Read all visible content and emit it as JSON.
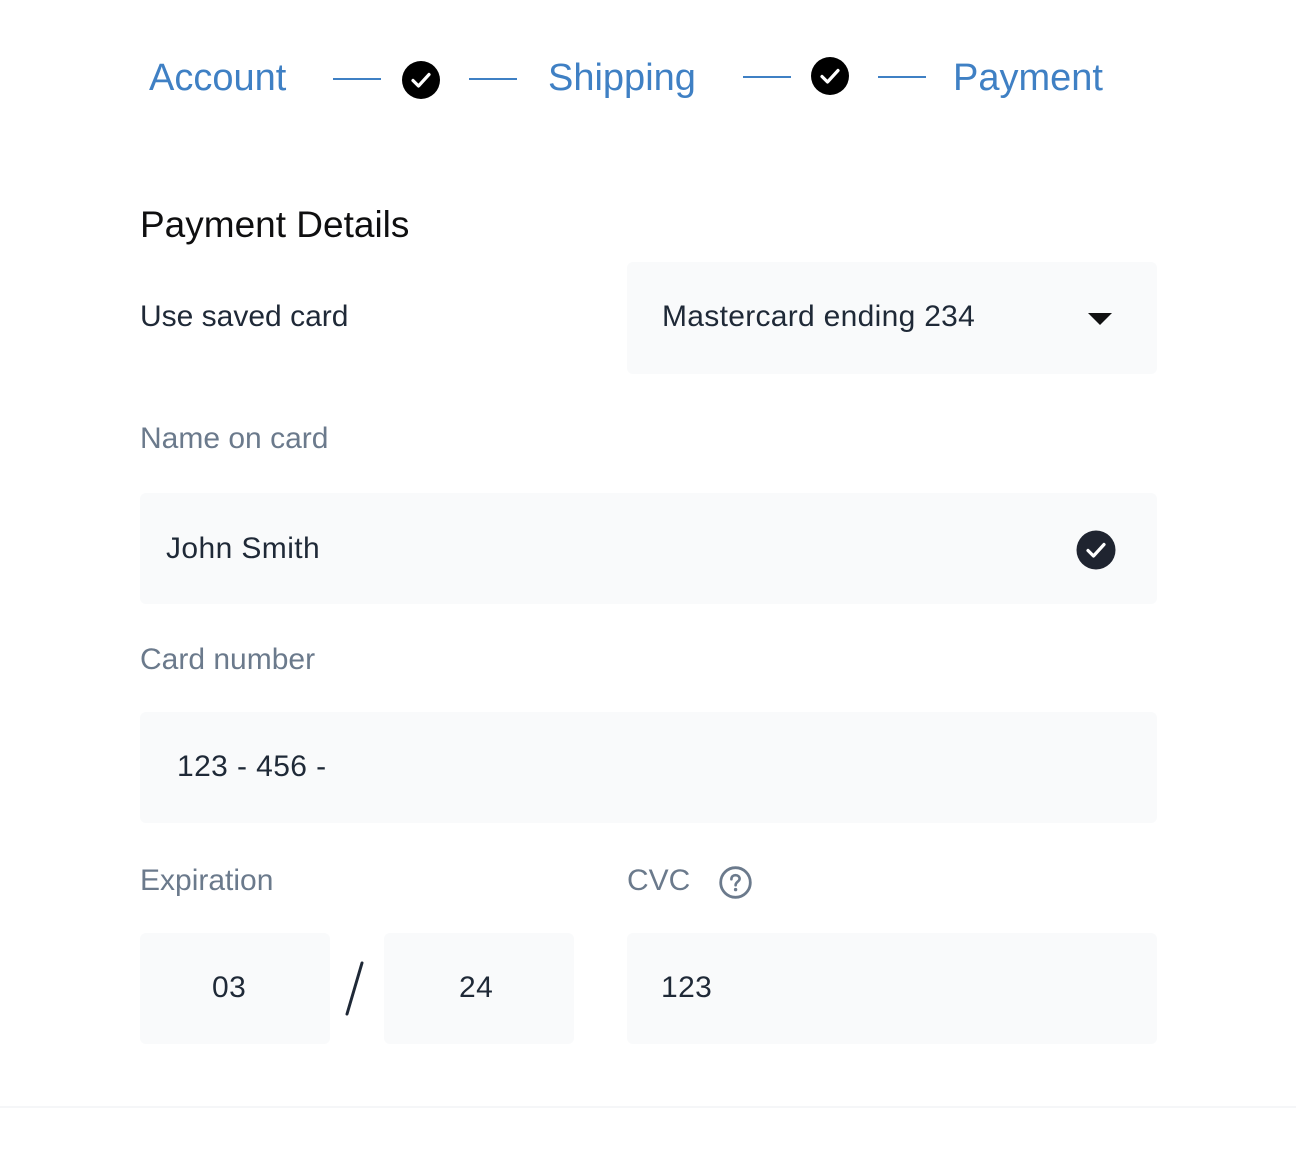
{
  "stepper": {
    "steps": [
      {
        "label": "Account",
        "completed": true
      },
      {
        "label": "Shipping",
        "completed": true
      },
      {
        "label": "Payment",
        "completed": false
      }
    ],
    "accent_color": "#3f80c4",
    "check_icon": "check-circle-icon"
  },
  "form": {
    "title": "Payment Details",
    "saved_card": {
      "label": "Use saved card",
      "selected_value": "Mastercard ending 234",
      "icon": "caret-down-icon"
    },
    "name_on_card": {
      "label": "Name on card",
      "value": "John Smith",
      "valid": true,
      "icon": "check-circle-icon"
    },
    "card_number": {
      "label": "Card number",
      "value": "123 - 456 -"
    },
    "expiration": {
      "label": "Expiration",
      "month": "03",
      "year": "24"
    },
    "cvc": {
      "label": "CVC",
      "value": "123",
      "help_icon": "question-circle-icon"
    }
  },
  "colors": {
    "field_background": "#f9fafb",
    "label_muted": "#6b7a8c",
    "text_primary": "#1f2937"
  }
}
